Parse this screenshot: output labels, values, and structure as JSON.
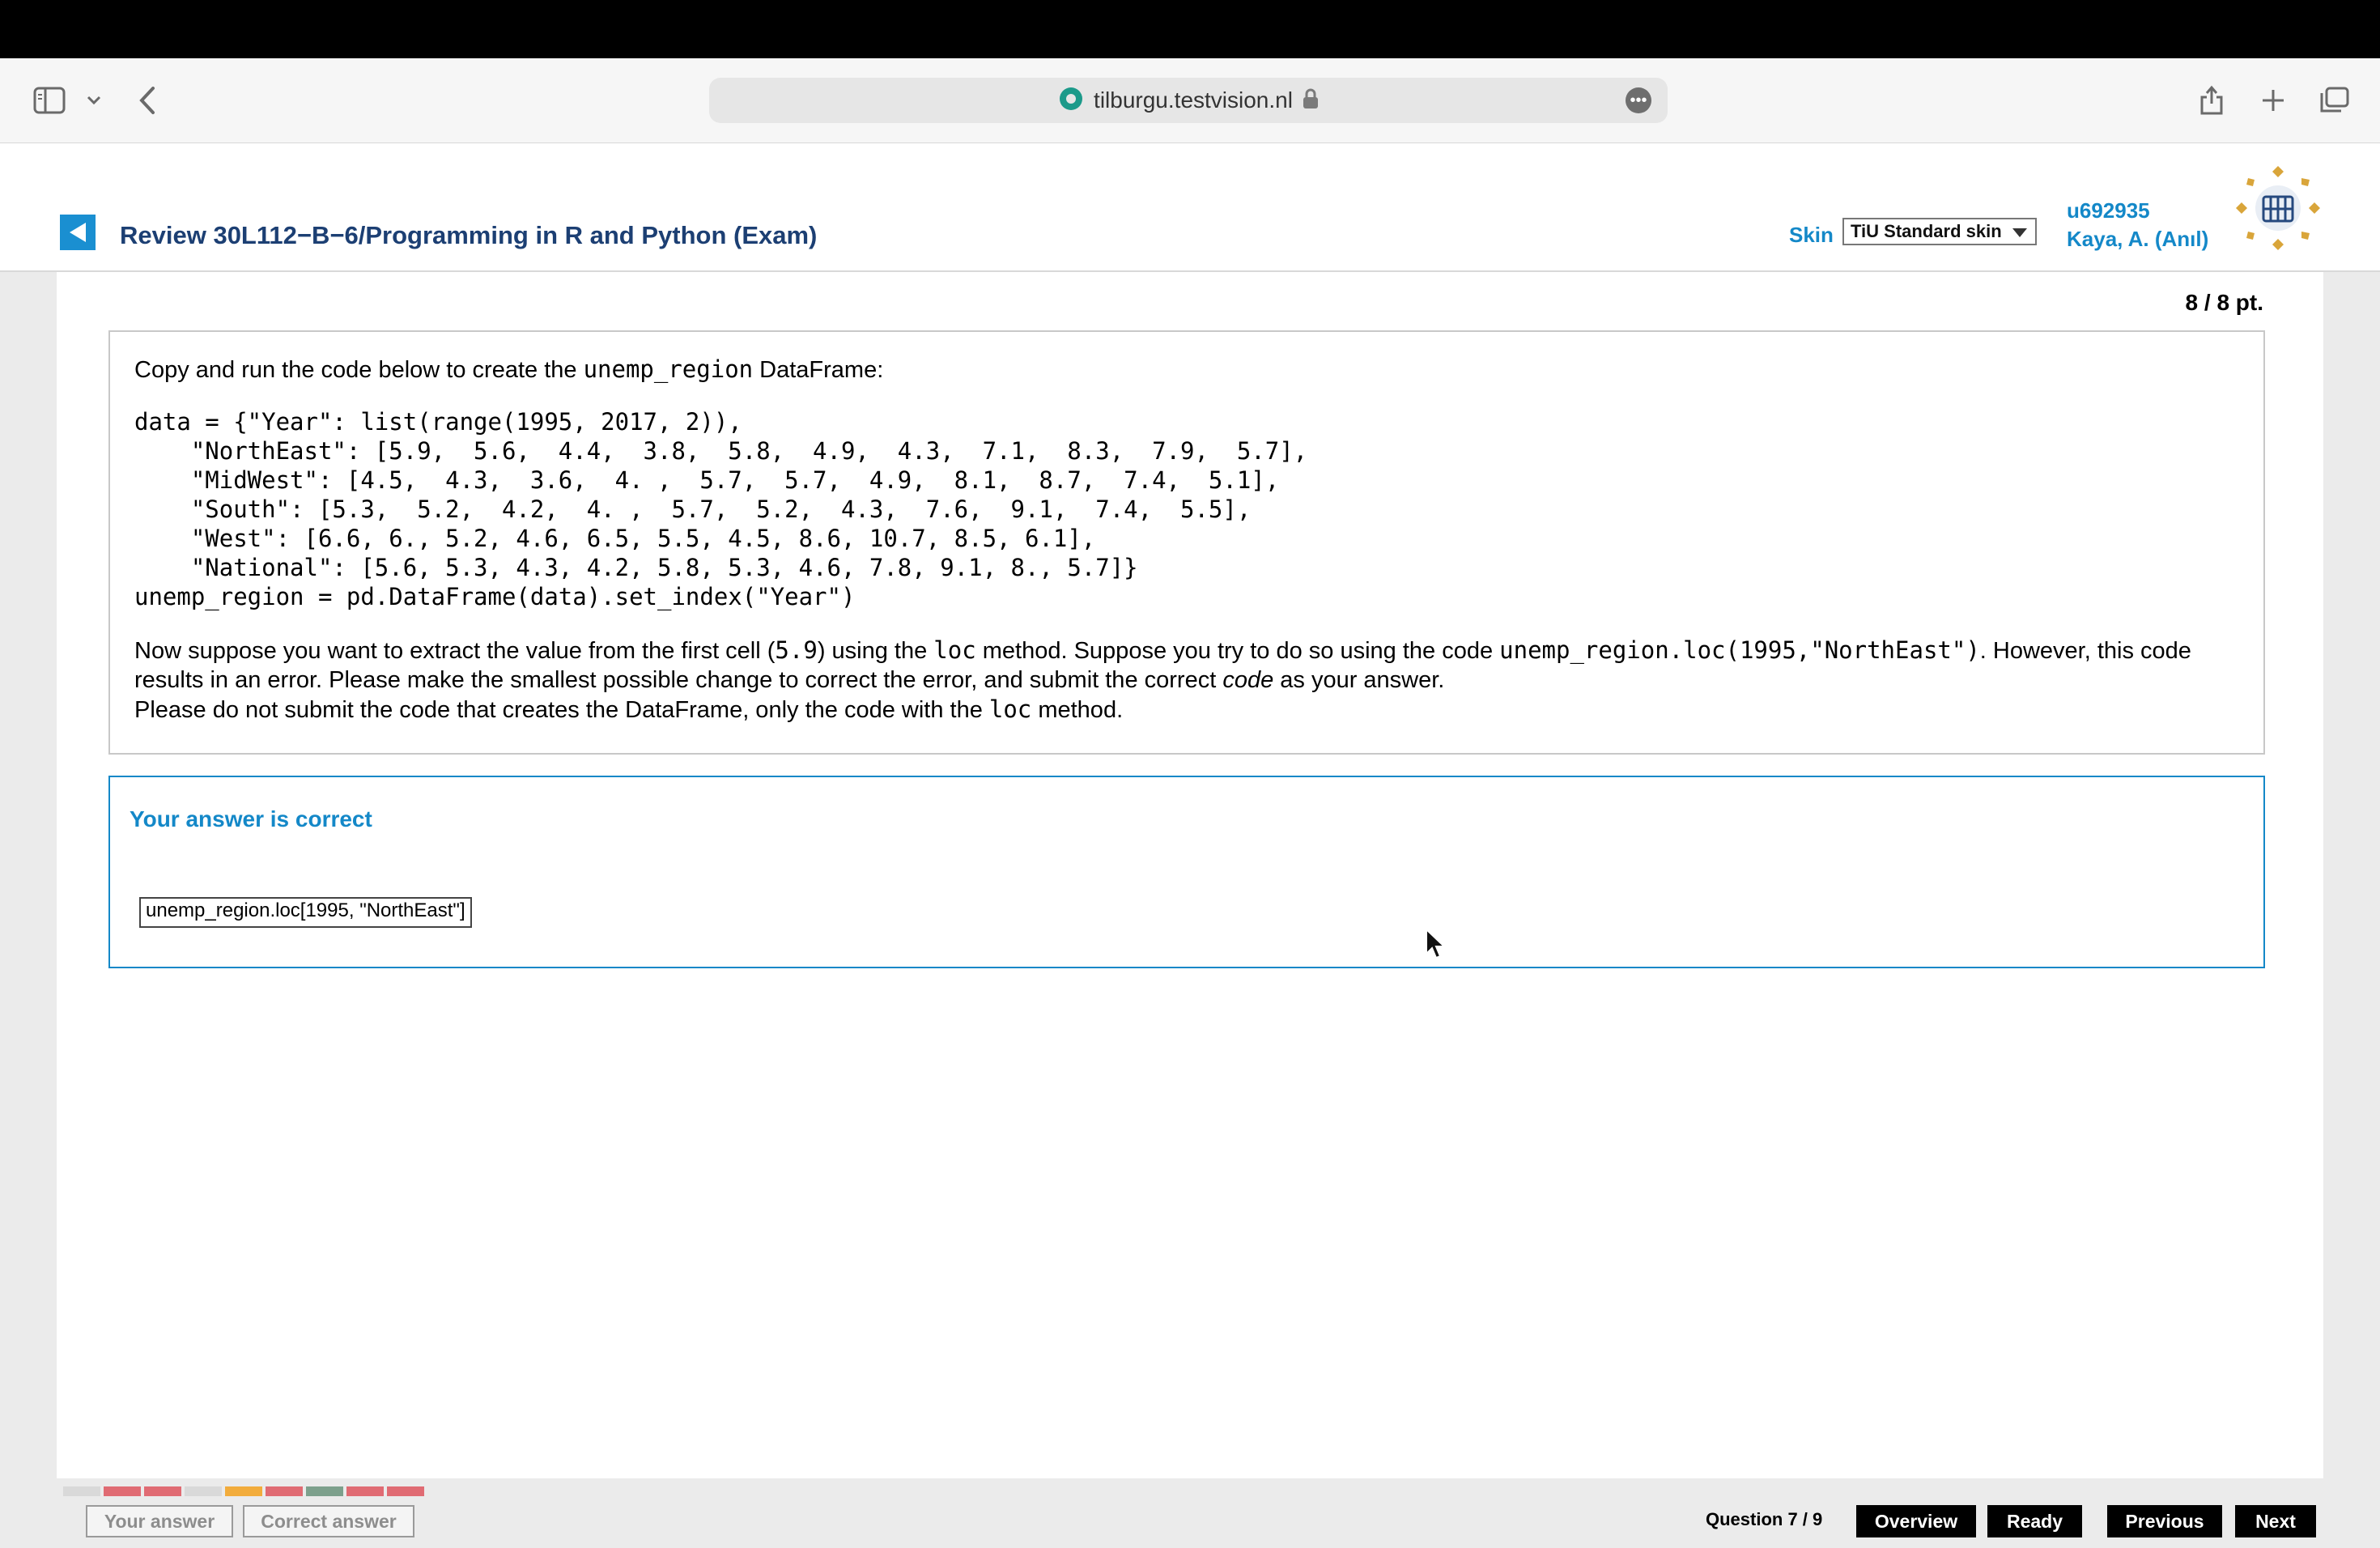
{
  "browser": {
    "url": "tilburgu.testvision.nl"
  },
  "header": {
    "title": "Review 30L112−B−6/Programming in R and Python (Exam)",
    "skin_label": "Skin",
    "skin_value": "TiU Standard skin",
    "user_id": "u692935",
    "user_name": "Kaya, A. (Anıl)"
  },
  "score": "8 / 8 pt.",
  "question": {
    "intro_prefix": "Copy and run the code below to create the ",
    "intro_code": "unemp_region",
    "intro_suffix": " DataFrame:",
    "code": "data = {\"Year\": list(range(1995, 2017, 2)),\n    \"NorthEast\": [5.9,  5.6,  4.4,  3.8,  5.8,  4.9,  4.3,  7.1,  8.3,  7.9,  5.7],\n    \"MidWest\": [4.5,  4.3,  3.6,  4. ,  5.7,  5.7,  4.9,  8.1,  8.7,  7.4,  5.1],\n    \"South\": [5.3,  5.2,  4.2,  4. ,  5.7,  5.2,  4.3,  7.6,  9.1,  7.4,  5.5],\n    \"West\": [6.6, 6., 5.2, 4.6, 6.5, 5.5, 4.5, 8.6, 10.7, 8.5, 6.1],\n    \"National\": [5.6, 5.3, 4.3, 4.2, 5.8, 5.3, 4.6, 7.8, 9.1, 8., 5.7]}\nunemp_region = pd.DataFrame(data).set_index(\"Year\")",
    "p2_a": "Now suppose you want to extract the value from the first cell (",
    "p2_code1": "5.9",
    "p2_b": ") using the ",
    "p2_code2": "loc",
    "p2_c": " method. Suppose you try to do so using the code ",
    "p2_code3": "unemp_region.loc(1995,\"NorthEast\")",
    "p2_d": ". However, this code results in an error. Please make the smallest possible change to correct the error, and submit the correct ",
    "p2_em": "code",
    "p2_e": " as your answer.",
    "p3_a": "Please do not submit the code that creates the DataFrame, only the code with the ",
    "p3_code": "loc",
    "p3_b": " method."
  },
  "answer": {
    "status": "Your answer is correct",
    "value": "unemp_region.loc[1995, \"NorthEast\"]"
  },
  "progress_colors": [
    "#d9d9d9",
    "#e06b73",
    "#e06b73",
    "#d9d9d9",
    "#f2ac3c",
    "#e06b73",
    "#7da08c",
    "#e06b73",
    "#e06b73"
  ],
  "footer": {
    "your_answer": "Your answer",
    "correct_answer": "Correct answer",
    "question_count": "Question 7 / 9",
    "overview": "Overview",
    "ready": "Ready",
    "previous": "Previous",
    "next": "Next"
  }
}
